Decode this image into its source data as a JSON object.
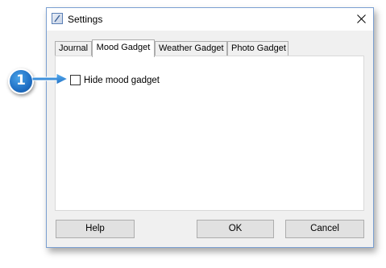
{
  "window": {
    "title": "Settings",
    "icon": "settings-app-icon"
  },
  "tabs": [
    {
      "label": "Journal",
      "active": false
    },
    {
      "label": "Mood Gadget",
      "active": true
    },
    {
      "label": "Weather Gadget",
      "active": false
    },
    {
      "label": "Photo Gadget",
      "active": false
    }
  ],
  "panel": {
    "hide_mood_gadget": {
      "label": "Hide mood gadget",
      "checked": false
    }
  },
  "buttons": {
    "help": "Help",
    "ok": "OK",
    "cancel": "Cancel"
  },
  "callout": {
    "number": "1",
    "color": "#1f6fc4"
  }
}
